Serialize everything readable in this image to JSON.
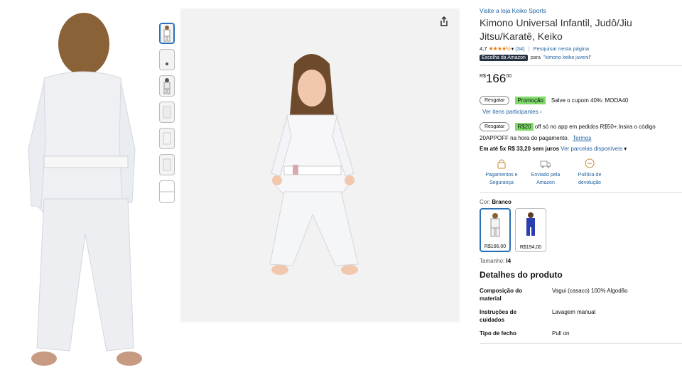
{
  "store": {
    "link": "Visite a loja Keiko Sports"
  },
  "product": {
    "title_line1": "Kimono Universal Infantil, Judô/Jiu",
    "title_line2": "Jitsu/Karatê, Keiko"
  },
  "rating": {
    "value": "4,7",
    "stars": "★★★★½",
    "count": "(34)",
    "search_link": "Pesquisar nesta página"
  },
  "choice": {
    "badge": "Escolha da Amazon",
    "for_prefix": "para",
    "query": "\"kimono keiko juvenil\""
  },
  "price": {
    "currency": "R$",
    "whole": "166",
    "cents": "00"
  },
  "coupon": {
    "redeem_label": "Resgatar",
    "promo_tag": "Promoção",
    "text": "Salve o cupom 40%: MODA40",
    "items_link": "Ver itens participantes ›"
  },
  "app_offer": {
    "redeem_label": "Resgatar",
    "amount_tag": "R$20",
    "text1": "off só no app em pedidos R$50+.Insira o código",
    "text2": "20APPOFF na hora do pagamento.",
    "terms_link": "Termos"
  },
  "installments": {
    "text": "Em até 5x R$ 33,20 sem juros",
    "link": "Ver parcelas disponíveis"
  },
  "features": [
    {
      "line1": "Pagamentos e",
      "line2": "Segurança"
    },
    {
      "line1": "Enviado pela",
      "line2": "Amazon"
    },
    {
      "line1": "Política de",
      "line2": "devolução"
    }
  ],
  "color": {
    "label": "Cor:",
    "selected": "Branco",
    "swatches": [
      {
        "price": "R$166,00"
      },
      {
        "price": "R$194,00"
      }
    ]
  },
  "size": {
    "label": "Tamanho:",
    "selected": "I4"
  },
  "details": {
    "title": "Detalhes do produto",
    "rows": [
      {
        "key1": "Composição do",
        "key2": "material",
        "value": "Vagui (casaco) 100% Algodão"
      },
      {
        "key1": "Instruções de",
        "key2": "cuidados",
        "value": "Lavagem manual"
      },
      {
        "key1": "Tipo de fecho",
        "key2": "",
        "value": "Pull on"
      }
    ]
  },
  "colors": {
    "link": "#2162a1",
    "promo": "#7fda69",
    "badge": "#232f3e",
    "star": "#e77600"
  }
}
